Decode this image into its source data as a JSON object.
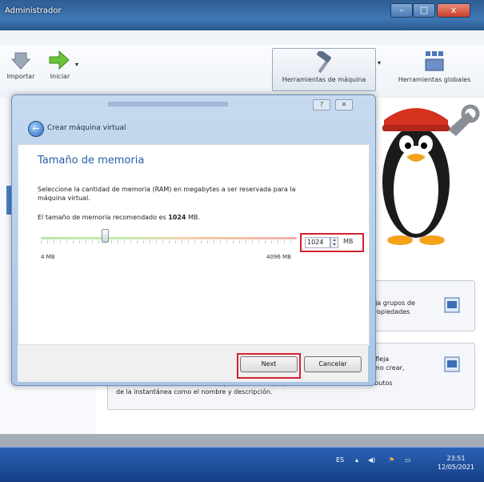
{
  "window": {
    "title": "Administrador",
    "controls": {
      "minimize": "–",
      "maximize": "□",
      "close": "x"
    }
  },
  "toolbar": {
    "import_label": "Importar",
    "start_label": "Iniciar",
    "machine_tools_label": "Herramientas de máquina",
    "global_tools_label": "Herramientas globales"
  },
  "dialog": {
    "title": "Crear máquina virtual",
    "section_title": "Tamaño de memoria",
    "description": "Seleccione la cantidad de memoria (RAM) en megabytes a ser reservada para la máquina virtual.",
    "recommended_prefix": "El tamaño de memoria recomendado es",
    "recommended_value": "1024",
    "recommended_suffix": "MB.",
    "slider_min": "4 MB",
    "slider_max": "4096 MB",
    "memory_value": "1024",
    "memory_unit": "MB",
    "memory_fraction": 0.25,
    "next_label": "Next",
    "cancel_label": "Cancelar"
  },
  "background": {
    "panel1_line1": "Refleja grupos de",
    "panel1_line2": "las propiedades",
    "panel2_line1": "Refleja",
    "panel2_line2": "tomo crear,",
    "panel2_line3": "Mostrar, restaurar, iniciar actual) y observar sus propiedades. Permite editar atributos",
    "panel2_line4": "de la instantánea como el nombre y descripción."
  },
  "taskbar": {
    "language": "ES",
    "time": "23:51",
    "date": "12/05/2021"
  },
  "colors": {
    "highlight_red": "#d52030",
    "title_blue": "#2a5ca6"
  }
}
